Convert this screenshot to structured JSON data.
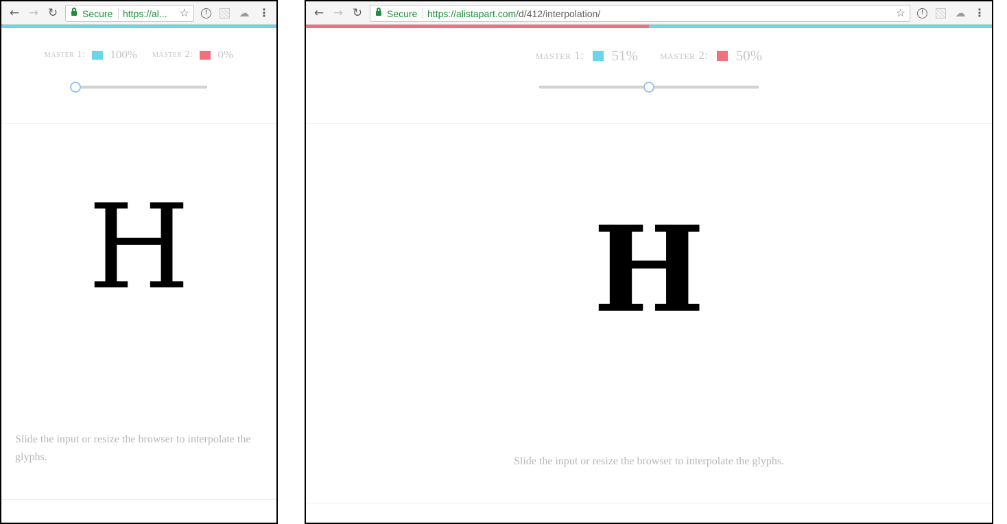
{
  "colors": {
    "master1": "#69d6ea",
    "master2": "#f0707b"
  },
  "browser": {
    "secure_label": "Secure",
    "url_left": "https://al...",
    "url_right_scheme_host": "https://alistapart.com",
    "url_right_path": "/d/412/interpolation/",
    "icons": [
      "back-arrow-icon",
      "forward-arrow-icon",
      "reload-icon",
      "lock-icon",
      "star-icon",
      "info-icon",
      "extension-icon",
      "cloud-icon",
      "menu-icon"
    ]
  },
  "left": {
    "master1_label": "master 1:",
    "master1_value": "100%",
    "master2_label": "master 2:",
    "master2_value": "0%",
    "slider_value": 0,
    "glyph": "H",
    "caption": "Slide the input or resize the browser to interpolate the glyphs."
  },
  "right": {
    "master1_label": "master 1:",
    "master1_value": "51%",
    "master2_label": "master 2:",
    "master2_value": "50%",
    "slider_value": 50,
    "progress_fill_percent": 50,
    "glyph": "H",
    "caption": "Slide the input or resize the browser to interpolate the glyphs."
  }
}
